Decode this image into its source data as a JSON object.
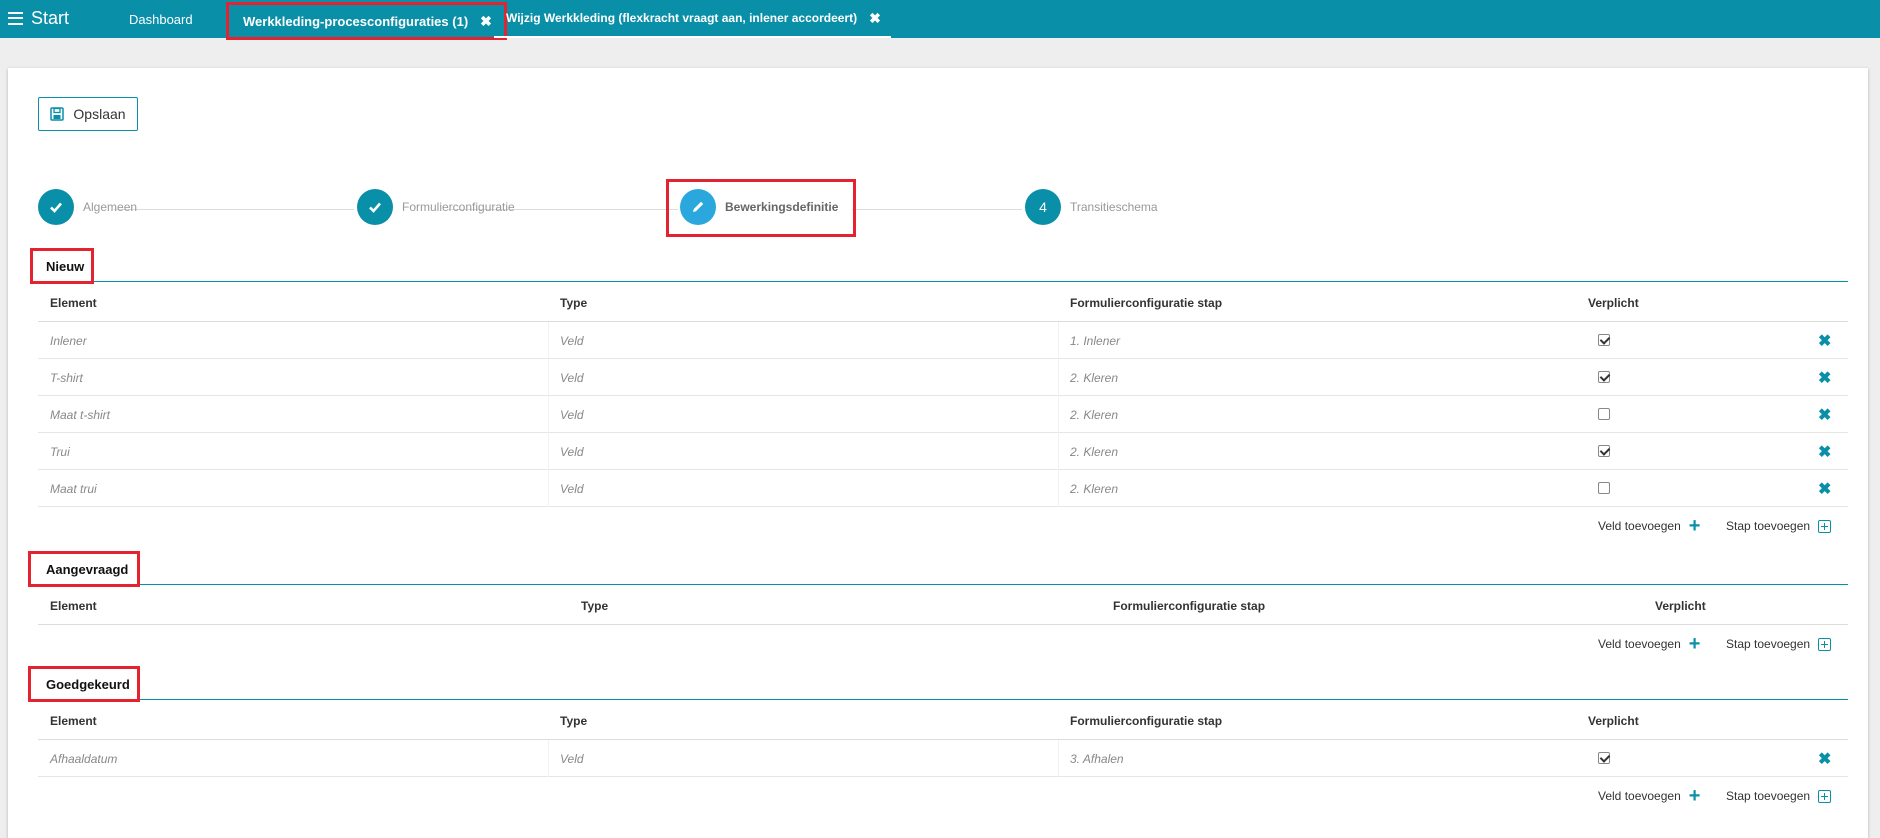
{
  "topbar": {
    "menu_label": "Start",
    "tabs": [
      {
        "label": "Dashboard"
      },
      {
        "label": "Werkkleding-procesconfiguraties (1)",
        "close": "✖"
      },
      {
        "label": "Wijzig Werkkleding (flexkracht vraagt aan, inlener accordeert)",
        "close": "✖"
      }
    ]
  },
  "toolbar": {
    "save_label": "Opslaan"
  },
  "stepper": {
    "steps": [
      {
        "label": "Algemeen",
        "state": "done"
      },
      {
        "label": "Formulierconfiguratie",
        "state": "done"
      },
      {
        "label": "Bewerkingsdefinitie",
        "state": "active"
      },
      {
        "label": "Transitieschema",
        "state": "pending",
        "number": "4"
      }
    ]
  },
  "columns": {
    "element": "Element",
    "type": "Type",
    "stap": "Formulierconfiguratie stap",
    "verplicht": "Verplicht"
  },
  "actions": {
    "add_field": "Veld toevoegen",
    "add_step": "Stap toevoegen"
  },
  "sections": [
    {
      "title": "Nieuw",
      "rows": [
        {
          "element": "Inlener",
          "type": "Veld",
          "stap": "1. Inlener",
          "verplicht": true
        },
        {
          "element": "T-shirt",
          "type": "Veld",
          "stap": "2. Kleren",
          "verplicht": true
        },
        {
          "element": "Maat t-shirt",
          "type": "Veld",
          "stap": "2. Kleren",
          "verplicht": false
        },
        {
          "element": "Trui",
          "type": "Veld",
          "stap": "2. Kleren",
          "verplicht": true
        },
        {
          "element": "Maat trui",
          "type": "Veld",
          "stap": "2. Kleren",
          "verplicht": false
        }
      ]
    },
    {
      "title": "Aangevraagd",
      "rows": []
    },
    {
      "title": "Goedgekeurd",
      "rows": [
        {
          "element": "Afhaaldatum",
          "type": "Veld",
          "stap": "3. Afhalen",
          "verplicht": true
        }
      ]
    }
  ],
  "colors": {
    "brand": "#0a8fa8",
    "active_step": "#2aa8dd",
    "highlight": "#e3232f"
  }
}
